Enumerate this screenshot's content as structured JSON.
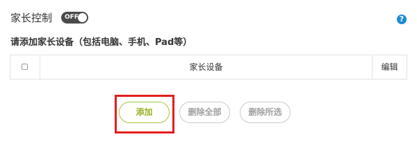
{
  "header": {
    "title": "家长控制",
    "toggle_label": "OFF",
    "help_icon": "?"
  },
  "section": {
    "title": "请添加家长设备（包括电脑、手机、Pad等）"
  },
  "table": {
    "columns": [
      "家长设备",
      "编辑"
    ],
    "rows": []
  },
  "buttons": {
    "add": "添加",
    "delete_all": "删除全部",
    "delete_selected": "删除所选"
  },
  "colors": {
    "accent_green": "#95b226",
    "highlight_red": "#e51c1c",
    "help_blue": "#1e8ad6",
    "toggle_dark": "#4a4a4a"
  }
}
